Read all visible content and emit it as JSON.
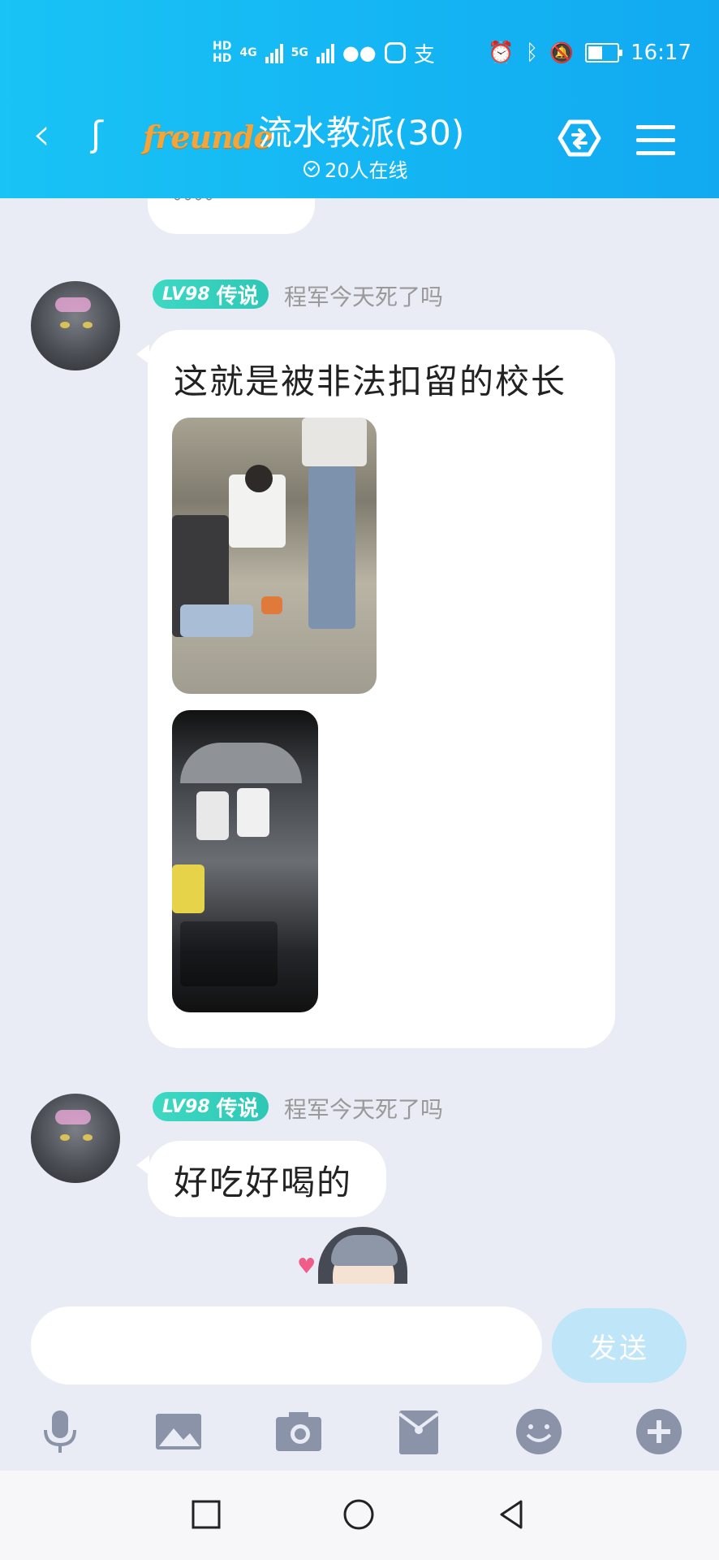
{
  "status_bar": {
    "hd1": "HD",
    "hd2": "HD",
    "net1": "4G",
    "net2": "5G",
    "time": "16:17"
  },
  "header": {
    "group_name": "流水教派",
    "member_count": "(30)",
    "online_text": "20人在线",
    "logo_text": "freunde"
  },
  "messages": [
    {
      "level": "LV98",
      "title": "传说",
      "sender": "程军今天死了吗",
      "text": "这就是被非法扣留的校长",
      "images": 2
    },
    {
      "level": "LV98",
      "title": "传说",
      "sender": "程军今天死了吗",
      "text": "好吃好喝的"
    }
  ],
  "input": {
    "placeholder": "",
    "send_label": "发送"
  },
  "toolbar": [
    "mic-icon",
    "image-icon",
    "camera-icon",
    "red-packet-icon",
    "emoji-icon",
    "plus-icon"
  ],
  "colors": {
    "header": "#14b4f3",
    "badge": "#2ec7b6",
    "send": "#bfe5f8",
    "background": "#e9ecf5"
  }
}
